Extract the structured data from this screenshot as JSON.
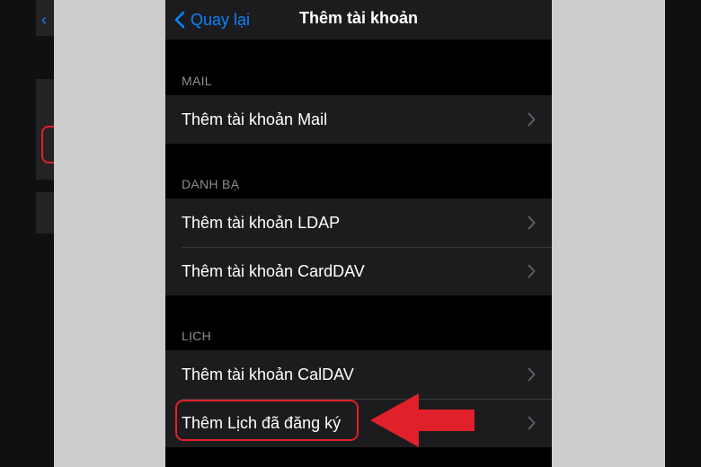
{
  "navbar": {
    "back_label": "Quay lại",
    "title": "Thêm tài khoản"
  },
  "sections": [
    {
      "header": "MAIL",
      "rows": [
        "Thêm tài khoản Mail"
      ]
    },
    {
      "header": "DANH BẠ",
      "rows": [
        "Thêm tài khoản LDAP",
        "Thêm tài khoản CardDAV"
      ]
    },
    {
      "header": "LỊCH",
      "rows": [
        "Thêm tài khoản CalDAV",
        "Thêm Lịch đã đăng ký"
      ]
    }
  ],
  "colors": {
    "accent": "#0a84ff",
    "annotation": "#e0202a"
  }
}
